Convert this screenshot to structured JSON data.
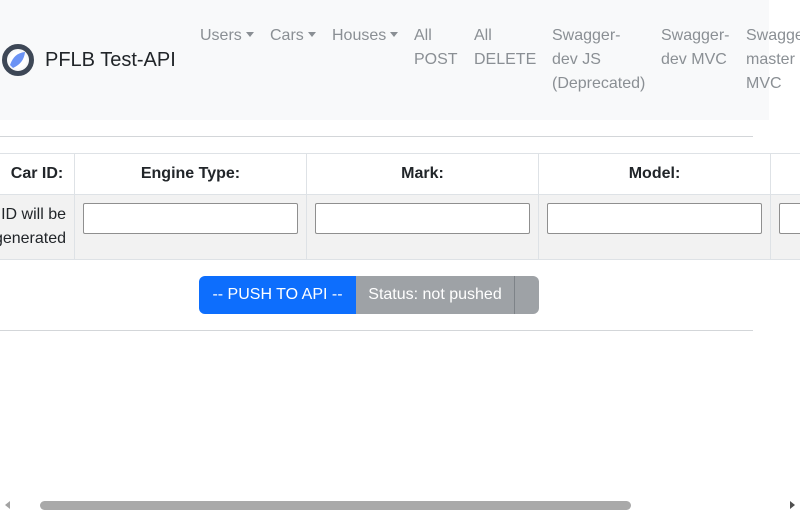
{
  "brand": {
    "name": "PFLB Test-API",
    "logo_icon": "pflb-logo-icon"
  },
  "nav": [
    {
      "lines": [
        "Users"
      ],
      "dropdown": true
    },
    {
      "lines": [
        "Cars"
      ],
      "dropdown": true
    },
    {
      "lines": [
        "Houses"
      ],
      "dropdown": true
    },
    {
      "lines": [
        "All",
        "POST"
      ],
      "dropdown": false
    },
    {
      "lines": [
        "All",
        "DELETE"
      ],
      "dropdown": false
    },
    {
      "lines": [
        "Swagger-",
        "dev JS",
        "(Deprecated)"
      ],
      "dropdown": false
    },
    {
      "lines": [
        "Swagger-",
        "dev MVC"
      ],
      "dropdown": false
    },
    {
      "lines": [
        "Swagge",
        "master",
        "MVC"
      ],
      "dropdown": false
    }
  ],
  "table": {
    "headers": [
      "Car ID:",
      "Engine Type:",
      "Mark:",
      "Model:",
      ""
    ],
    "id_note": [
      "ID will be",
      "generated"
    ],
    "inputs": {
      "engine_type": "",
      "mark": "",
      "model": "",
      "next": ""
    }
  },
  "actions": {
    "push_label": "-- PUSH TO API --",
    "status_label": "Status: not pushed"
  },
  "colors": {
    "primary": "#0d6efd",
    "secondary": "#9ea2a6",
    "navbar_bg": "#f8f9fa",
    "nav_link": "#8a8f94"
  }
}
